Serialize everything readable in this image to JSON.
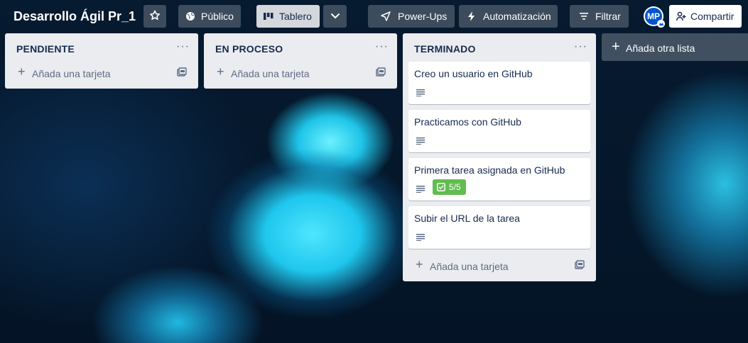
{
  "header": {
    "board_title": "Desarrollo Ágil Pr_1",
    "visibility_label": "Público",
    "view_label": "Tablero",
    "powerups_label": "Power-Ups",
    "automation_label": "Automatización",
    "filter_label": "Filtrar",
    "avatar_initials": "MP",
    "share_label": "Compartir"
  },
  "lists": [
    {
      "title": "PENDIENTE",
      "menu": "···",
      "add_card_label": "Añada una tarjeta",
      "cards": []
    },
    {
      "title": "EN PROCESO",
      "menu": "···",
      "add_card_label": "Añada una tarjeta",
      "cards": []
    },
    {
      "title": "TERMINADO",
      "menu": "···",
      "add_card_label": "Añada una tarjeta",
      "cards": [
        {
          "title": "Creo un usuario en GitHub",
          "has_description": true
        },
        {
          "title": "Practicamos con GitHub",
          "has_description": true
        },
        {
          "title": "Primera tarea asignada en GitHub",
          "has_description": true,
          "checklist": "5/5"
        },
        {
          "title": "Subir el URL de la tarea",
          "has_description": true
        }
      ]
    }
  ],
  "add_list_label": "Añada otra lista",
  "colors": {
    "list_bg": "#ebecf0",
    "checklist_complete": "#61bd4f",
    "avatar": "#0055cc"
  }
}
